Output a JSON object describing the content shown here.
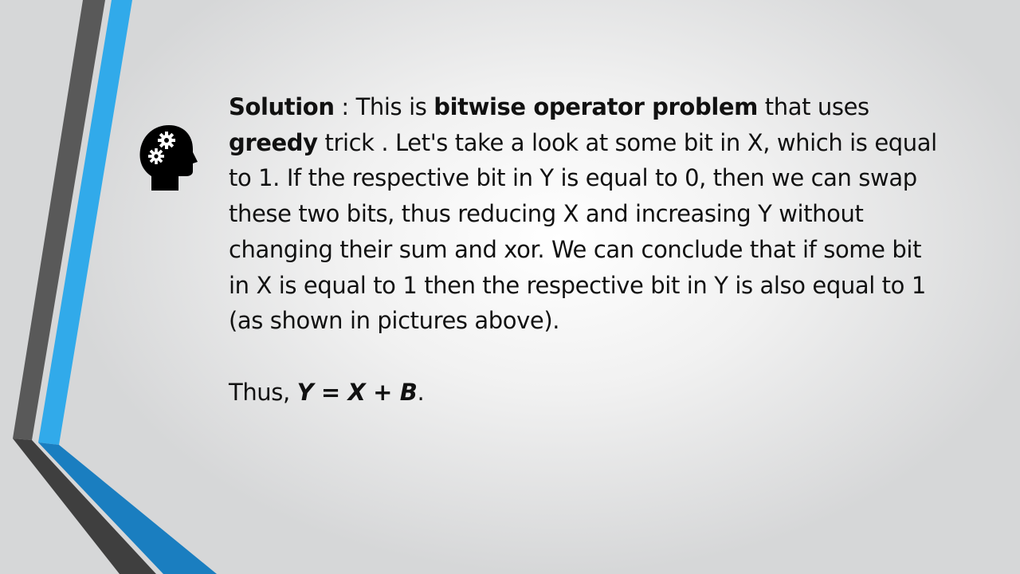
{
  "slide": {
    "solution": {
      "label": "Solution",
      "sep": " : This is ",
      "term": "bitwise operator problem",
      "mid": " that uses",
      "greedy": "greedy",
      "rest": " trick . Let's take a look at some bit in X, which is equal to 1. If the respective bit in Y is equal to 0, then we can swap these two bits, thus reducing X and increasing Y without changing their sum and xor. We can conclude that if some bit in X is equal to 1 then the respective bit in Y is also equal to 1 (as shown in pictures above)."
    },
    "conclusion": {
      "lead": "Thus, ",
      "formula": "Y = X + B",
      "end": "."
    },
    "icon": "head-with-gears-icon",
    "colors": {
      "accent_blue": "#2fa8e6",
      "dark_blue": "#1577b8",
      "gray_bar": "#595959",
      "text": "#111111"
    }
  }
}
